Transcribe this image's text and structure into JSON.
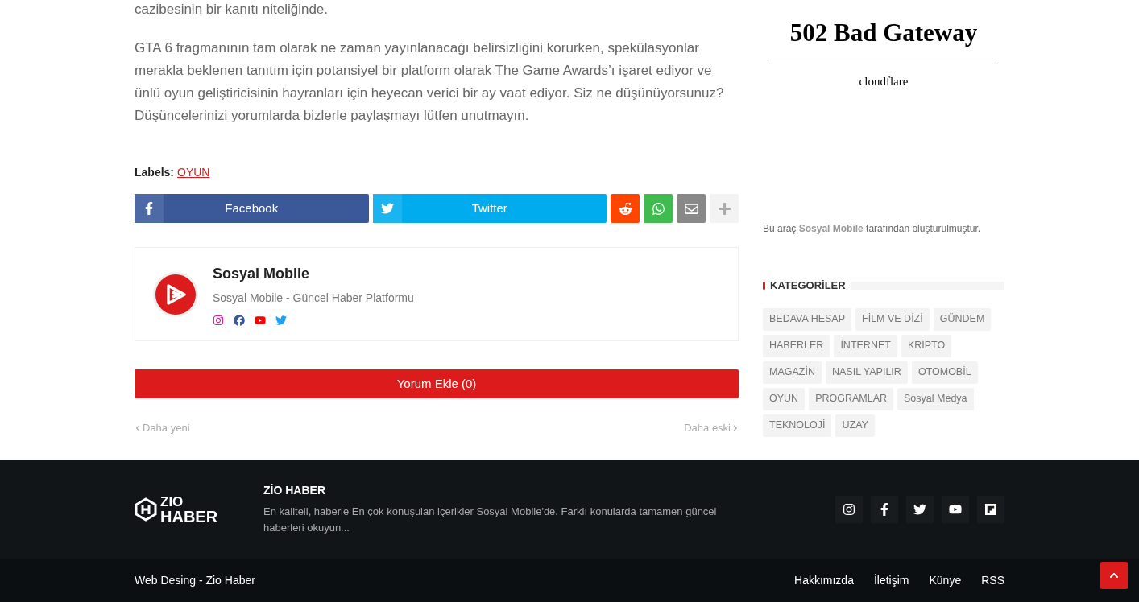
{
  "article": {
    "paragraphs": [
      "cazibesinin bir kanıtı niteliğinde.",
      "GTA 6 fragmanının tam olarak ne zaman yayınlanacağı belirsizliğini korurken, spekülasyonlar merakla beklenen tanıtım için potansiyel bir platform olarak The Game Awards’ı işaret ediyor ve ünlü oyun geliştiricisinin hayranları için heyecan verici bir ay vaat ediyor. Siz ne düşünüyorsunuz? Düşüncelerinizi yorumlarda bizlerle paylaşmayı lütfen unutmayın."
    ],
    "labels_title": "Labels:",
    "labels": [
      "OYUN"
    ],
    "share": [
      {
        "kind": "facebook",
        "label": "Facebook"
      },
      {
        "kind": "twitter",
        "label": "Twitter"
      },
      {
        "kind": "reddit"
      },
      {
        "kind": "whatsapp"
      },
      {
        "kind": "email"
      },
      {
        "kind": "more"
      }
    ],
    "author": {
      "name": "Sosyal Mobile",
      "description": "Sosyal Mobile - Güncel Haber Platformu",
      "links": [
        {
          "kind": "instagram"
        },
        {
          "kind": "facebook"
        },
        {
          "kind": "youtube"
        },
        {
          "kind": "twitter"
        }
      ]
    },
    "comment_button": "Yorum Ekle (0)",
    "pager": {
      "newer": "Daha yeni",
      "older": "Daha eski"
    }
  },
  "sidebar": {
    "error": {
      "title": "502 Bad Gateway",
      "server": "cloudflare"
    },
    "credit": "Bu araç **Sosyal Mobile** tarafından oluşturulmuştur.",
    "categories_title": "KATEGORİLER",
    "categories": [
      "BEDAVA HESAP",
      "FİLM VE DİZİ",
      "GÜNDEM",
      "HABERLER",
      "İNTERNET",
      "KRİPTO",
      "MAGAZİN",
      "NASIL YAPILIR",
      "OTOMOBİL",
      "OYUN",
      "PROGRAMLAR",
      "Sosyal Medya",
      "TEKNOLOJİ",
      "UZAY"
    ]
  },
  "footer": {
    "logo_top": "ZIO",
    "logo_bottom": "HABER",
    "title": "ZİO HABER",
    "description": "En kaliteli, haberle En çok konuşulan içerikler Sosyal Mobile'de. Farklı konularda tamamen güncel haberleri okuyun...",
    "social": [
      {
        "kind": "instagram"
      },
      {
        "kind": "facebook"
      },
      {
        "kind": "twitter"
      },
      {
        "kind": "youtube"
      },
      {
        "kind": "flipboard"
      }
    ],
    "copyright": "Web Desing - Zio Haber",
    "links": [
      "Hakkımızda",
      "İletişim",
      "Künye",
      "RSS"
    ]
  }
}
